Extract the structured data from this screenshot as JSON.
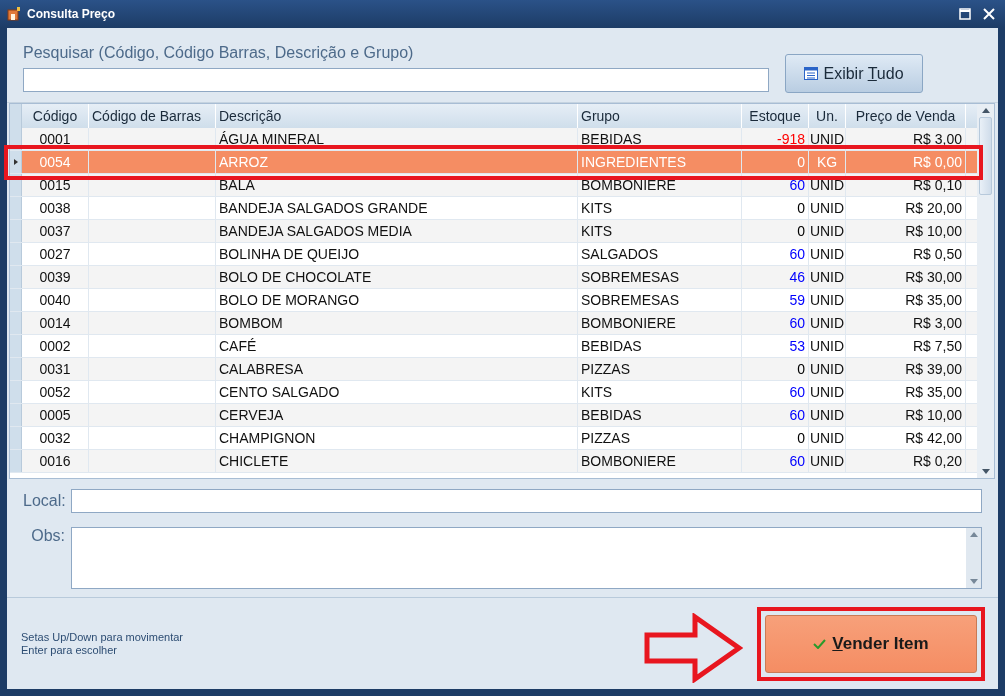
{
  "window": {
    "title": "Consulta Preço"
  },
  "search": {
    "label": "Pesquisar (Código, Código Barras, Descrição e Grupo)"
  },
  "show_all_button": {
    "label": "Exibir Tudo"
  },
  "table": {
    "columns": [
      "Código",
      "Código de Barras",
      "Descrição",
      "Grupo",
      "Estoque",
      "Un.",
      "Preço de Venda"
    ],
    "rows": [
      {
        "codigo": "0001",
        "descricao": "ÁGUA MINERAL",
        "grupo": "BEBIDAS",
        "estoque": "-918",
        "color": "#ff0000",
        "un": "UNID",
        "preco": "R$ 3,00",
        "selected": false
      },
      {
        "codigo": "0054",
        "descricao": "ARROZ",
        "grupo": "INGREDIENTES",
        "estoque": "0",
        "color": "#ffffff",
        "un": "KG",
        "preco": "R$ 0,00",
        "selected": true
      },
      {
        "codigo": "0015",
        "descricao": "BALA",
        "grupo": "BOMBONIERE",
        "estoque": "60",
        "color": "#0000ff",
        "un": "UNID",
        "preco": "R$ 0,10",
        "selected": false
      },
      {
        "codigo": "0038",
        "descricao": "BANDEJA SALGADOS GRANDE",
        "grupo": "KITS",
        "estoque": "0",
        "color": "#000000",
        "un": "UNID",
        "preco": "R$ 20,00",
        "selected": false
      },
      {
        "codigo": "0037",
        "descricao": "BANDEJA SALGADOS MEDIA",
        "grupo": "KITS",
        "estoque": "0",
        "color": "#000000",
        "un": "UNID",
        "preco": "R$ 10,00",
        "selected": false
      },
      {
        "codigo": "0027",
        "descricao": "BOLINHA DE QUEIJO",
        "grupo": "SALGADOS",
        "estoque": "60",
        "color": "#0000ff",
        "un": "UNID",
        "preco": "R$ 0,50",
        "selected": false
      },
      {
        "codigo": "0039",
        "descricao": "BOLO DE CHOCOLATE",
        "grupo": "SOBREMESAS",
        "estoque": "46",
        "color": "#0000ff",
        "un": "UNID",
        "preco": "R$ 30,00",
        "selected": false
      },
      {
        "codigo": "0040",
        "descricao": "BOLO DE MORANGO",
        "grupo": "SOBREMESAS",
        "estoque": "59",
        "color": "#0000ff",
        "un": "UNID",
        "preco": "R$ 35,00",
        "selected": false
      },
      {
        "codigo": "0014",
        "descricao": "BOMBOM",
        "grupo": "BOMBONIERE",
        "estoque": "60",
        "color": "#0000ff",
        "un": "UNID",
        "preco": "R$ 3,00",
        "selected": false
      },
      {
        "codigo": "0002",
        "descricao": "CAFÉ",
        "grupo": "BEBIDAS",
        "estoque": "53",
        "color": "#0000ff",
        "un": "UNID",
        "preco": "R$ 7,50",
        "selected": false
      },
      {
        "codigo": "0031",
        "descricao": "CALABRESA",
        "grupo": "PIZZAS",
        "estoque": "0",
        "color": "#000000",
        "un": "UNID",
        "preco": "R$ 39,00",
        "selected": false
      },
      {
        "codigo": "0052",
        "descricao": "CENTO SALGADO",
        "grupo": "KITS",
        "estoque": "60",
        "color": "#0000ff",
        "un": "UNID",
        "preco": "R$ 35,00",
        "selected": false
      },
      {
        "codigo": "0005",
        "descricao": "CERVEJA",
        "grupo": "BEBIDAS",
        "estoque": "60",
        "color": "#0000ff",
        "un": "UNID",
        "preco": "R$ 10,00",
        "selected": false
      },
      {
        "codigo": "0032",
        "descricao": "CHAMPIGNON",
        "grupo": "PIZZAS",
        "estoque": "0",
        "color": "#000000",
        "un": "UNID",
        "preco": "R$ 42,00",
        "selected": false
      },
      {
        "codigo": "0016",
        "descricao": "CHICLETE",
        "grupo": "BOMBONIERE",
        "estoque": "60",
        "color": "#0000ff",
        "un": "UNID",
        "preco": "R$ 0,20",
        "selected": false
      }
    ]
  },
  "local": {
    "label": "Local:"
  },
  "obs": {
    "label": "Obs:"
  },
  "hints": [
    "Setas Up/Down para movimentar",
    "Enter para escolher"
  ],
  "sell_button": {
    "label": "Vender Item"
  }
}
